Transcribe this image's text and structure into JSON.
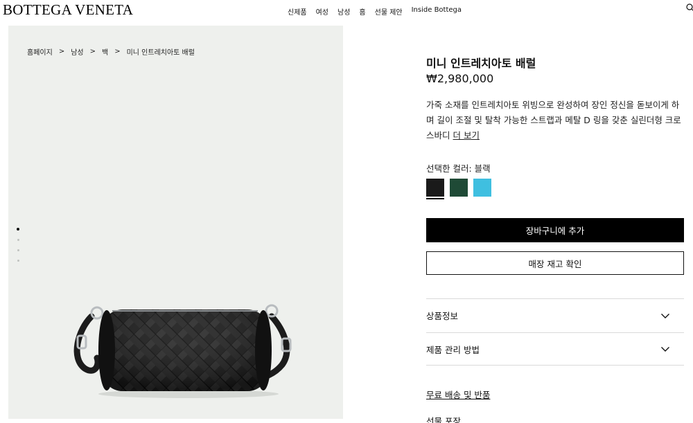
{
  "header": {
    "logo": "BOTTEGA VENETA",
    "nav": [
      "신제품",
      "여성",
      "남성",
      "홈",
      "선물 제안",
      "Inside Bottega"
    ],
    "search_icon": "search-icon"
  },
  "breadcrumb": [
    "홈페이지",
    "남성",
    "백",
    "미니 인트레치아토 배럴"
  ],
  "breadcrumb_separator": ">",
  "gallery": {
    "slide_count": 4,
    "active_slide": 1,
    "background": "#eef0ed"
  },
  "product": {
    "title": "미니 인트레치아토 배럴",
    "price": "₩2,980,000",
    "description": "가죽 소재를 인트레치아토 위빙으로 완성하여 장인 정신을 돋보이게 하며 길이 조절 및 탈착 가능한 스트랩과 메탈 D 링을 갖춘 실린더형 크로스바디",
    "more_link": "더 보기",
    "color_label": "선택한 컬러: 블랙",
    "swatches": [
      {
        "name": "블랙",
        "color": "#1a1a1a",
        "selected": true
      },
      {
        "name": "그린",
        "color": "#1f4a36",
        "selected": false
      },
      {
        "name": "블루",
        "color": "#3fbfe0",
        "selected": false
      }
    ],
    "add_to_cart": "장바구니에 추가",
    "check_stock": "매장 재고 확인",
    "accordion": [
      "상품정보",
      "제품 관리 방법"
    ],
    "shipping_link": "무료 배송 및 반품",
    "gift_wrap": "선물 포장"
  }
}
